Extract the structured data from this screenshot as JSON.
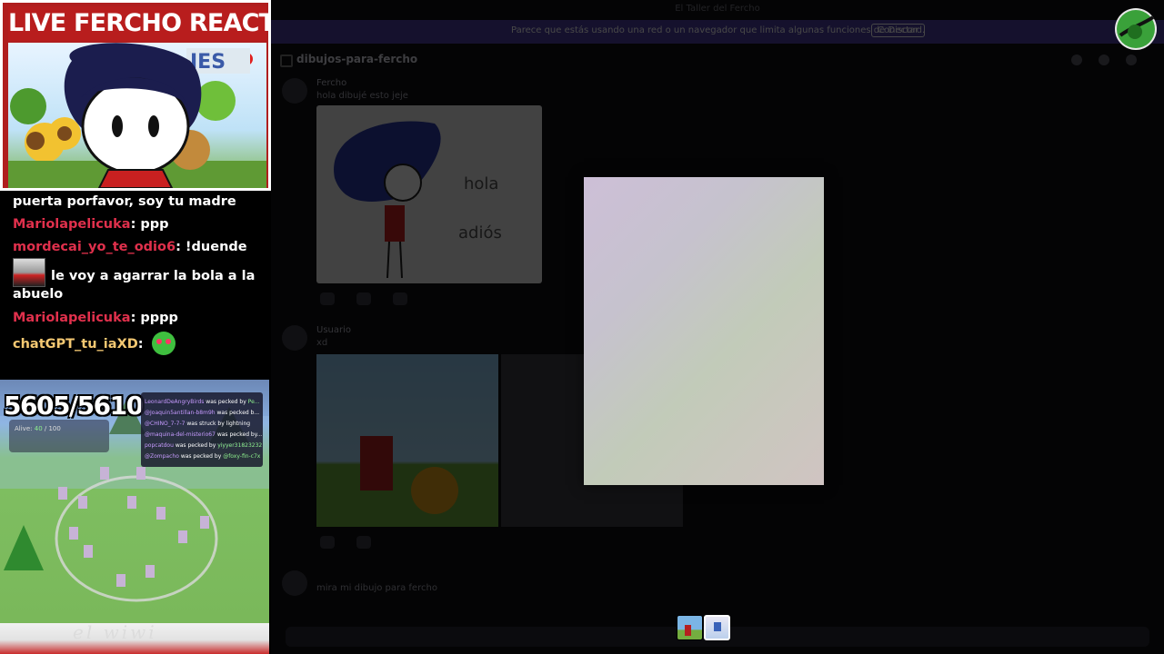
{
  "stream_overlay": {
    "live_title": "LIVE FERCHO REACTION",
    "art_fragment": "IES",
    "chat": [
      {
        "user": "",
        "message": "puerta porfavor, soy tu madre",
        "user_color": "#ffffff"
      },
      {
        "user": "Mariolapelicuka",
        "message": ": ppp",
        "user_color": "#e0304c"
      },
      {
        "user": "mordecai_yo_te_odio6",
        "message": ": !duende",
        "user_color": "#e0304c"
      },
      {
        "user": "",
        "message": "le voy a agarrar la bola a la",
        "user_color": "#ffffff"
      },
      {
        "user": "",
        "message": "abuelo",
        "user_color": "#ffffff"
      },
      {
        "user": "Mariolapelicuka",
        "message": ": pppp",
        "user_color": "#e0304c"
      },
      {
        "user": "chatGPT_tu_iaXD",
        "message": ":",
        "user_color": "#f4c872"
      }
    ],
    "game": {
      "counter": "5605/5610",
      "alive_label": "Alive:",
      "alive_value": "40",
      "alive_total": "/ 100",
      "killfeed": [
        {
          "name": "LeonardDeAngryBirds",
          "action": "was pecked by",
          "by": "Pe..."
        },
        {
          "name": "@Joaquin5antillan-b8m9h",
          "action": "was pecked b...",
          "by": ""
        },
        {
          "name": "@CHINO_7-7-7",
          "action": "was struck by lightning",
          "by": ""
        },
        {
          "name": "@maquina-del-misterio67",
          "action": "was pecked by...",
          "by": ""
        },
        {
          "name": "popcatdou",
          "action": "was pecked by",
          "by": "yiyyer31823232"
        },
        {
          "name": "@Zompacho",
          "action": "was pecked by",
          "by": "@foxy-fin-c7x"
        }
      ]
    },
    "bottom_text": "el wiwi"
  },
  "app": {
    "window_title": "El Taller del Fercho",
    "notice_text": "Parece que estás usando una red o un navegador que limita algunas funciones de Discord.",
    "notice_button": "Conectar",
    "channel_name": "dibujos-para-fercho",
    "messages": [
      {
        "author": "Fercho",
        "text": "hola dibujé esto jeje"
      },
      {
        "author": "Usuario",
        "text": "xd"
      },
      {
        "author": "Usuario",
        "text": "mira mi dibujo para fercho"
      }
    ],
    "card_words": [
      "hola",
      "adiós"
    ]
  },
  "viewer": {
    "thumb_count": 2
  },
  "colors": {
    "live_red": "#b81d1d",
    "chat_user_red": "#e0304c",
    "chat_user_gold": "#f4c872",
    "notice_purple": "#4b3ea0"
  }
}
